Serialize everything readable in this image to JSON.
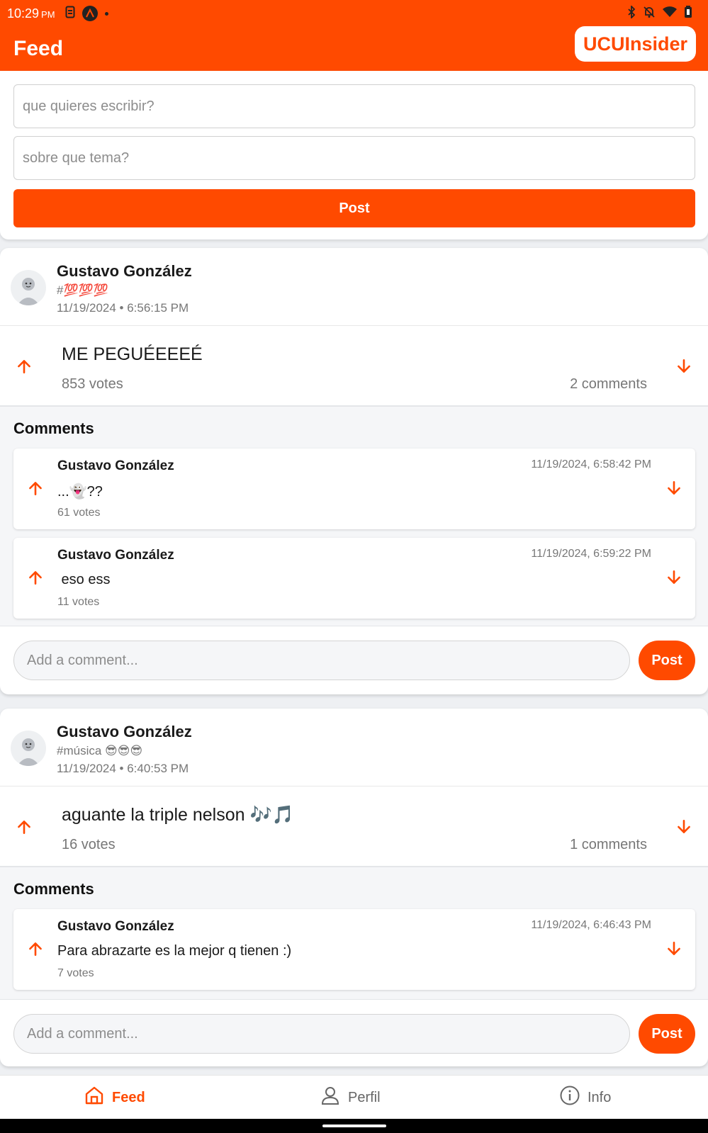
{
  "status_bar": {
    "time": "10:29",
    "ampm": "PM",
    "left_icons": [
      "sim-icon",
      "app-badge-icon",
      "dot-icon"
    ],
    "right_icons": [
      "bluetooth-icon",
      "mute-icon",
      "wifi-icon",
      "battery-icon"
    ]
  },
  "header": {
    "title": "Feed",
    "brand": "UCUInsider"
  },
  "composer": {
    "content_placeholder": "que quieres escribir?",
    "topic_placeholder": "sobre que tema?",
    "post_label": "Post"
  },
  "posts": [
    {
      "author": "Gustavo González",
      "topic": "#💯💯💯",
      "date": "11/19/2024 • 6:56:15 PM",
      "content": "ME PEGUÉEEEÉ",
      "votes": "853 votes",
      "comment_count": "2 comments",
      "comments_title": "Comments",
      "comments": [
        {
          "author": "Gustavo González",
          "time": "11/19/2024, 6:58:42 PM",
          "text": "...👻??",
          "votes": "61 votes"
        },
        {
          "author": "Gustavo González",
          "time": "11/19/2024, 6:59:22 PM",
          "text": " eso ess",
          "votes": "11 votes"
        }
      ],
      "add_comment_placeholder": "Add a comment...",
      "post_label": "Post"
    },
    {
      "author": "Gustavo González",
      "topic": "#música 😎😎😎",
      "date": "11/19/2024 • 6:40:53 PM",
      "content": "aguante la triple nelson 🎶🎵",
      "votes": "16 votes",
      "comment_count": "1 comments",
      "comments_title": "Comments",
      "comments": [
        {
          "author": "Gustavo González",
          "time": "11/19/2024, 6:46:43 PM",
          "text": "Para abrazarte es la mejor q tienen :)",
          "votes": "7 votes"
        }
      ],
      "add_comment_placeholder": "Add a comment...",
      "post_label": "Post"
    }
  ],
  "nav": {
    "items": [
      {
        "label": "Feed",
        "icon": "home-icon",
        "active": true
      },
      {
        "label": "Perfil",
        "icon": "person-icon",
        "active": false
      },
      {
        "label": "Info",
        "icon": "info-icon",
        "active": false
      }
    ]
  },
  "colors": {
    "accent": "#ff4a00",
    "background": "#eef0f3",
    "card": "#ffffff",
    "muted_text": "#777777"
  }
}
